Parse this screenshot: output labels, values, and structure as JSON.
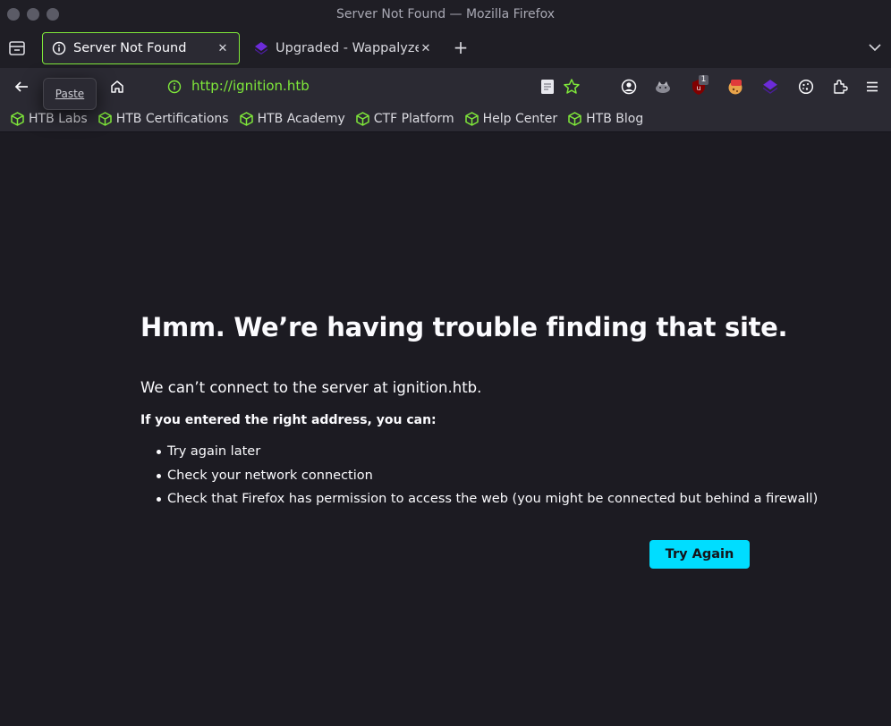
{
  "window": {
    "title": "Server Not Found — Mozilla Firefox"
  },
  "tabs": [
    {
      "label": "Server Not Found",
      "active": true
    },
    {
      "label": "Upgraded - Wappalyzer",
      "active": false
    }
  ],
  "tooltip": {
    "label": "Paste"
  },
  "urlbar": {
    "url": "http://ignition.htb"
  },
  "extensions": {
    "ublock_badge": "1"
  },
  "bookmarks": [
    {
      "label": "HTB Labs"
    },
    {
      "label": "HTB Certifications"
    },
    {
      "label": "HTB Academy"
    },
    {
      "label": "CTF Platform"
    },
    {
      "label": "Help Center"
    },
    {
      "label": "HTB Blog"
    }
  ],
  "error_page": {
    "title": "Hmm. We’re having trouble finding that site.",
    "description": "We can’t connect to the server at ignition.htb.",
    "subtitle": "If you entered the right address, you can:",
    "suggestions": [
      "Try again later",
      "Check your network connection",
      "Check that Firefox has permission to access the web (you might be connected but behind a firewall)"
    ],
    "button_label": "Try Again"
  },
  "colors": {
    "accent_green": "#7fe83a",
    "button_cyan": "#00ddff",
    "page_bg": "#1c1b22",
    "toolbar_bg": "#2b2a33"
  }
}
